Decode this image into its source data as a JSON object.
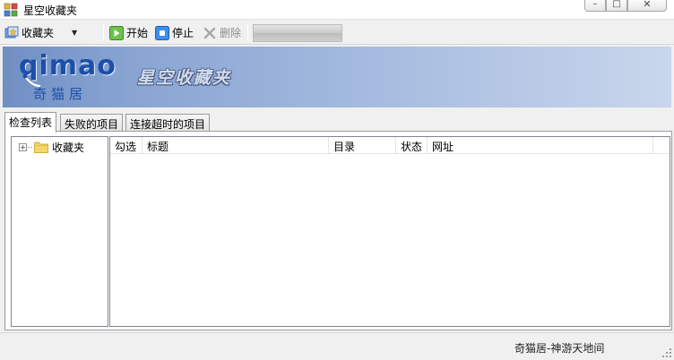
{
  "window": {
    "title": "星空收藏夹"
  },
  "toolbar": {
    "favorites_label": "收藏夹",
    "start_label": "开始",
    "stop_label": "停止",
    "delete_label": "删除"
  },
  "banner": {
    "logo_latin": "qimao",
    "logo_cn": "奇猫居",
    "title": "星空收藏夹"
  },
  "tabs": [
    {
      "label": "检查列表",
      "active": true
    },
    {
      "label": "失败的项目",
      "active": false
    },
    {
      "label": "连接超时的项目",
      "active": false
    }
  ],
  "tree": {
    "root_label": "收藏夹",
    "expander": "+"
  },
  "list": {
    "columns": [
      "勾选",
      "标题",
      "目录",
      "状态",
      "网址"
    ],
    "rows": []
  },
  "statusbar": {
    "text": "奇猫居-神游天地间"
  },
  "colors": {
    "banner_start": "#6f8fc4",
    "banner_end": "#c9d6ec",
    "logo_blue": "#1d4fa8"
  }
}
